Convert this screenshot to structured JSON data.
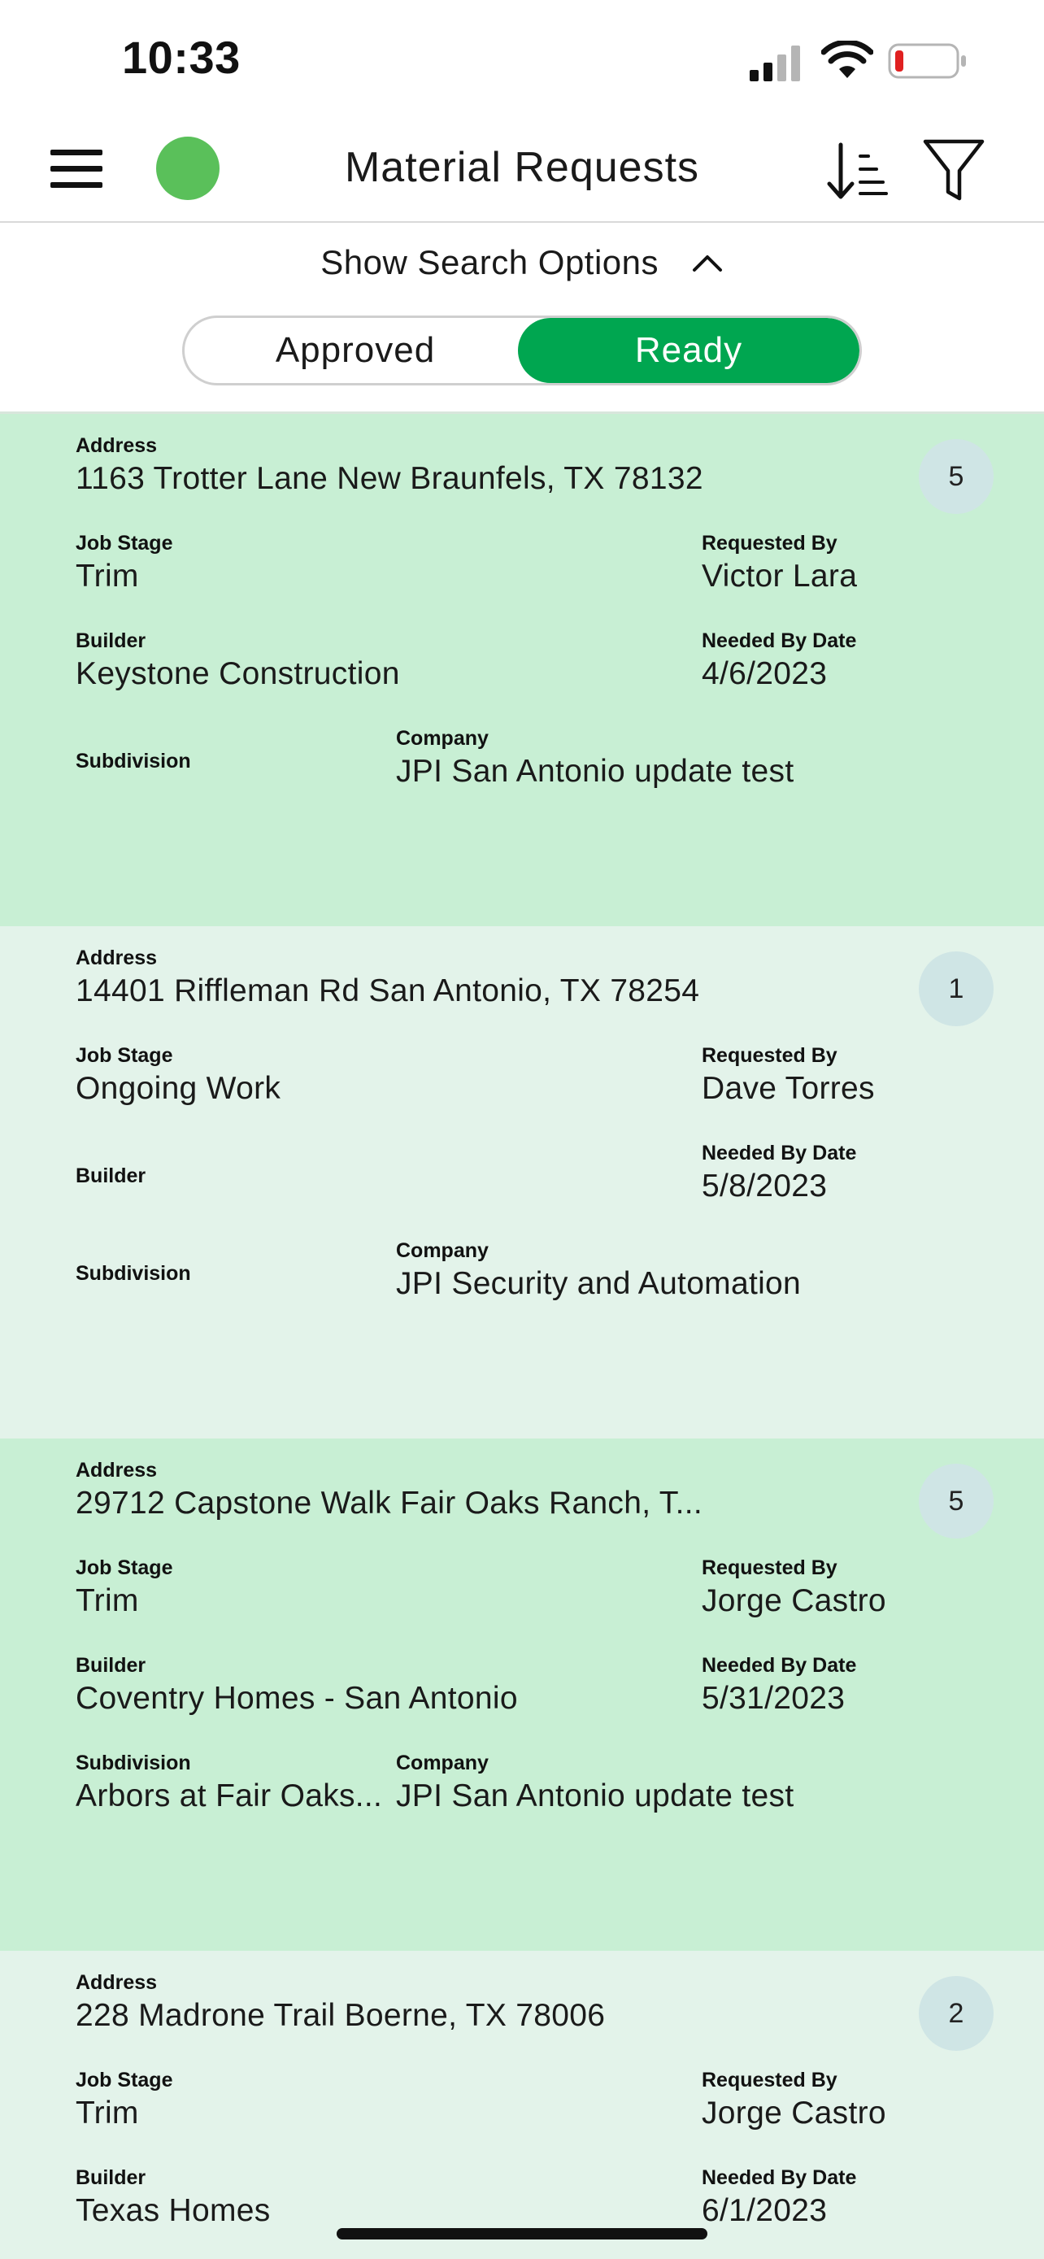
{
  "status_bar": {
    "time": "10:33"
  },
  "header": {
    "title": "Material Requests",
    "status_color": "#5ac05a"
  },
  "search": {
    "toggle_label": "Show Search Options"
  },
  "segment": {
    "left_label": "Approved",
    "right_label": "Ready",
    "selected": "Ready",
    "active_color": "#00a650"
  },
  "labels": {
    "address": "Address",
    "job_stage": "Job Stage",
    "requested_by": "Requested By",
    "builder": "Builder",
    "needed_by": "Needed By Date",
    "subdivision": "Subdivision",
    "company": "Company"
  },
  "colors": {
    "card_dark": "#c8efd4",
    "card_light": "#e3f3ea",
    "badge": "#cfe5e5"
  },
  "requests": [
    {
      "address": "1163 Trotter Lane New Braunfels, TX 78132",
      "count": "5",
      "job_stage": "Trim",
      "requested_by": "Victor Lara",
      "builder": "Keystone Construction",
      "needed_by": "4/6/2023",
      "subdivision": "",
      "company": "JPI San Antonio update test"
    },
    {
      "address": "14401 Riffleman Rd San Antonio, TX 78254",
      "count": "1",
      "job_stage": "Ongoing Work",
      "requested_by": "Dave Torres",
      "builder": "",
      "needed_by": "5/8/2023",
      "subdivision": "",
      "company": "JPI Security and Automation"
    },
    {
      "address": "29712 Capstone Walk Fair Oaks Ranch, T...",
      "count": "5",
      "job_stage": "Trim",
      "requested_by": "Jorge  Castro",
      "builder": "Coventry Homes - San Antonio",
      "needed_by": "5/31/2023",
      "subdivision": "Arbors at Fair Oaks...",
      "company": "JPI San Antonio update test"
    },
    {
      "address": "228 Madrone Trail Boerne, TX 78006",
      "count": "2",
      "job_stage": "Trim",
      "requested_by": "Jorge  Castro",
      "builder": "Texas Homes",
      "needed_by": "6/1/2023",
      "subdivision": "",
      "company": ""
    }
  ]
}
